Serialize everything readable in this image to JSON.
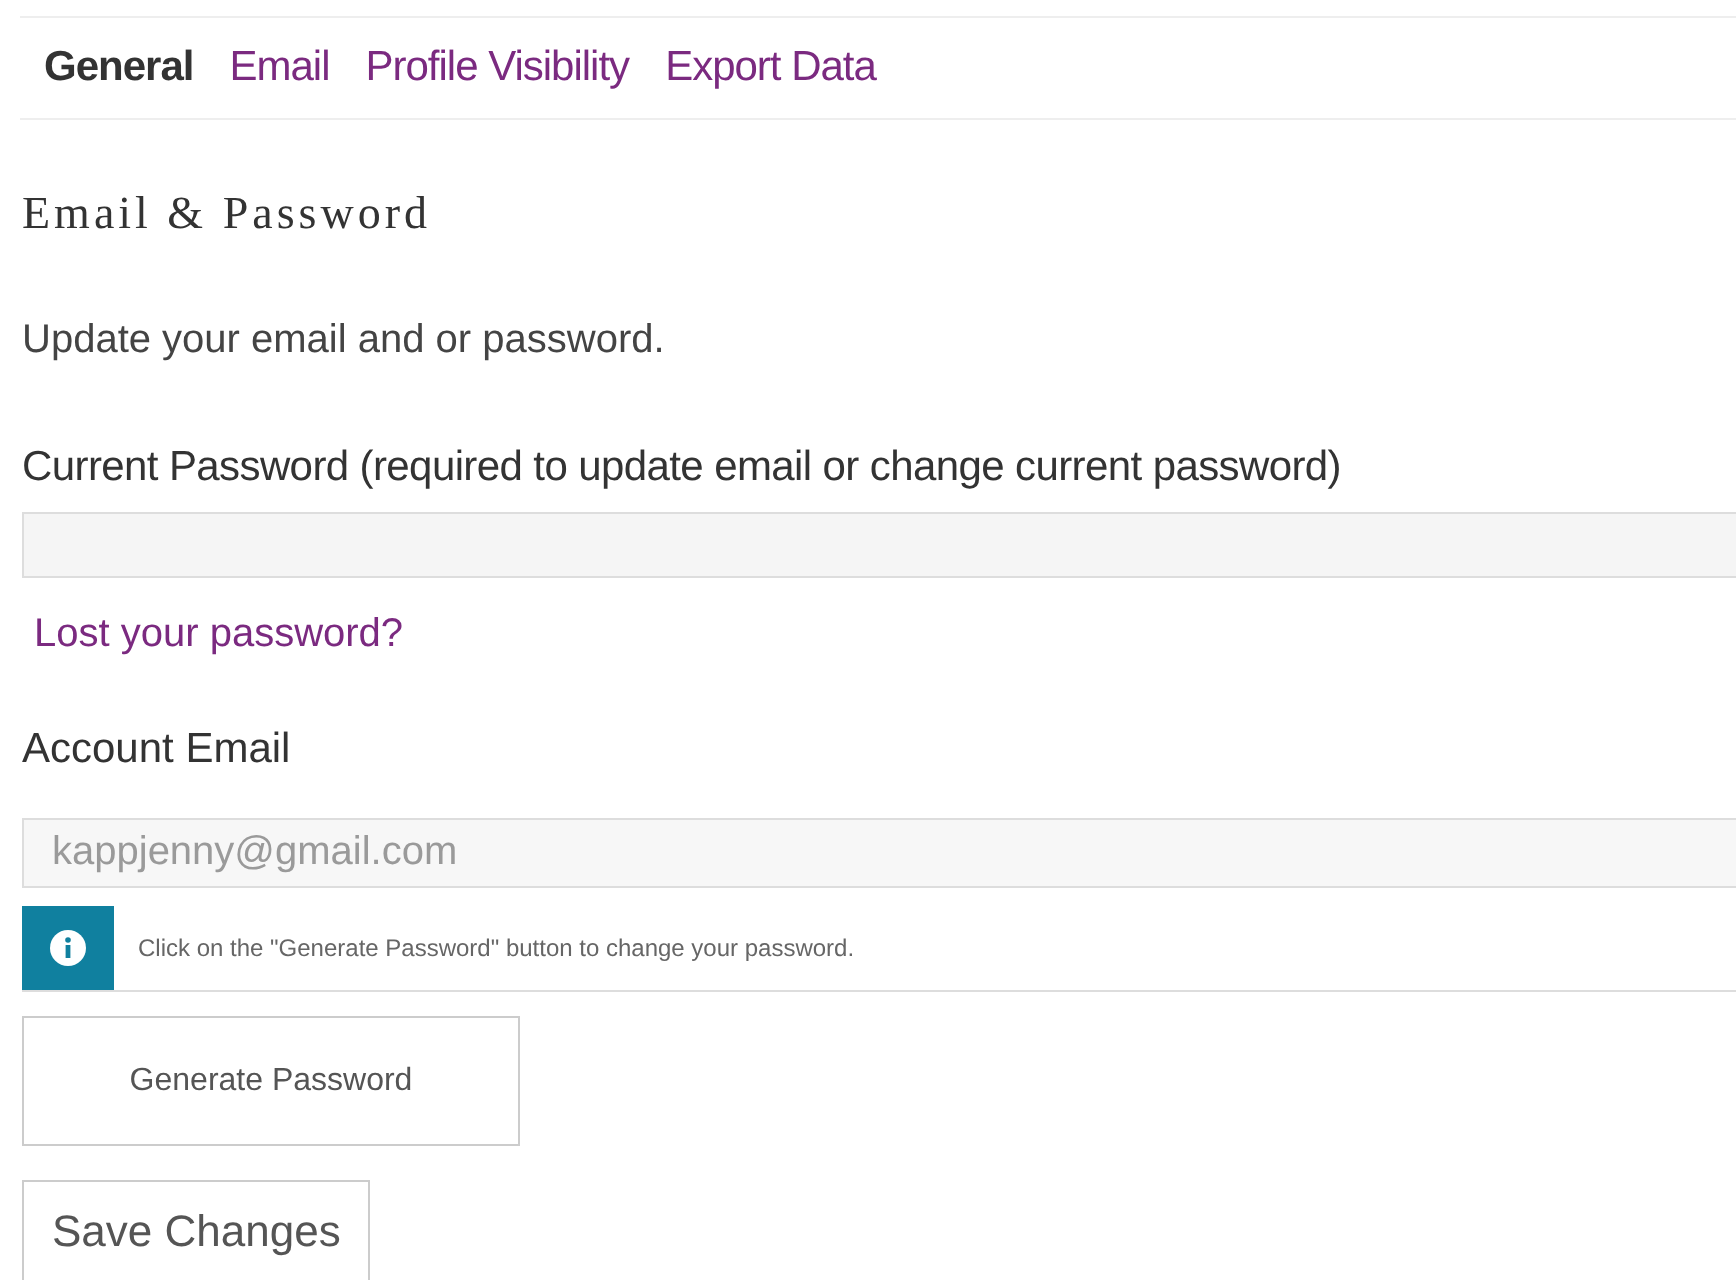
{
  "tabs": [
    {
      "label": "General",
      "selected": true
    },
    {
      "label": "Email",
      "selected": false
    },
    {
      "label": "Profile Visibility",
      "selected": false
    },
    {
      "label": "Export Data",
      "selected": false
    }
  ],
  "section_title": "Email & Password",
  "description": "Update your email and or password.",
  "current_password": {
    "label": "Current Password (required to update email or change current password)"
  },
  "lost_password_link": "Lost your password?",
  "account_email": {
    "label": "Account Email",
    "value": "kappjenny@gmail.com",
    "disabled": true
  },
  "notice": "Click on the \"Generate Password\" button to change your password.",
  "generate_button": "Generate Password",
  "save_button": "Save Changes"
}
